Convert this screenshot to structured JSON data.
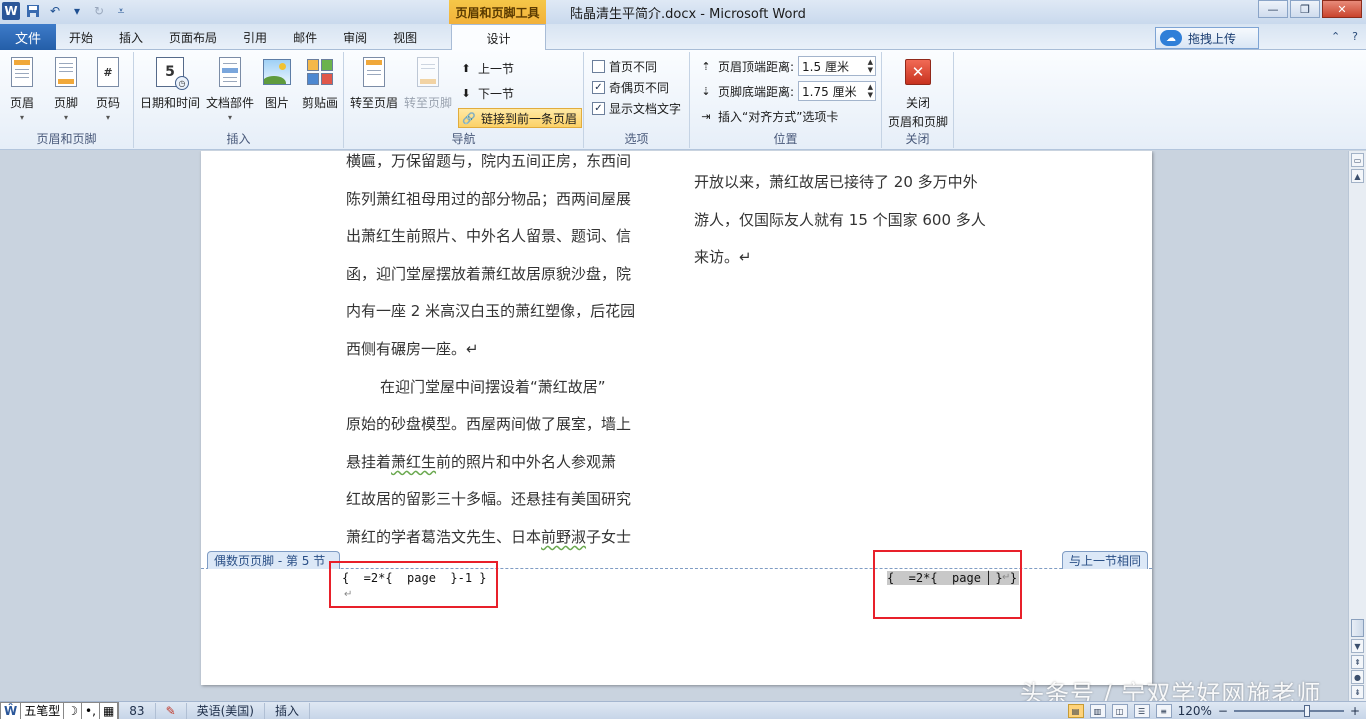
{
  "window": {
    "title": "陆晶清生平简介.docx - Microsoft Word",
    "context_tab_header": "页眉和页脚工具",
    "controls": [
      "—",
      "❐",
      "✕"
    ]
  },
  "qat": {
    "logo": "W",
    "undo_dropdown": "▾"
  },
  "tabs": {
    "file": "文件",
    "items": [
      "开始",
      "插入",
      "页面布局",
      "引用",
      "邮件",
      "审阅",
      "视图"
    ],
    "design": "设计"
  },
  "upload": {
    "label": "拖拽上传",
    "icon": "cloud-icon"
  },
  "ribbon": {
    "groups": {
      "header_footer": {
        "label": "页眉和页脚",
        "buttons": [
          {
            "label": "页眉",
            "icon": "header-icon"
          },
          {
            "label": "页脚",
            "icon": "footer-icon"
          },
          {
            "label": "页码",
            "icon": "page-number-icon"
          }
        ]
      },
      "insert": {
        "label": "插入",
        "buttons": [
          {
            "label": "日期和时间",
            "icon": "calendar-icon"
          },
          {
            "label": "文档部件",
            "icon": "quick-parts-icon"
          },
          {
            "label": "图片",
            "icon": "picture-icon"
          },
          {
            "label": "剪贴画",
            "icon": "clipart-icon"
          }
        ]
      },
      "navigation": {
        "label": "导航",
        "goto_header": "转至页眉",
        "goto_footer": "转至页脚",
        "previous": "上一节",
        "next": "下一节",
        "link_previous": "链接到前一条页眉"
      },
      "options": {
        "label": "选项",
        "items": [
          {
            "label": "首页不同",
            "checked": false
          },
          {
            "label": "奇偶页不同",
            "checked": true
          },
          {
            "label": "显示文档文字",
            "checked": true
          }
        ]
      },
      "position": {
        "label": "位置",
        "header_top_label": "页眉顶端距离:",
        "header_top_value": "1.5 厘米",
        "footer_bottom_label": "页脚底端距离:",
        "footer_bottom_value": "1.75 厘米",
        "insert_align_tab": "插入“对齐方式”选项卡"
      },
      "close": {
        "label": "关闭",
        "button_line1": "关闭",
        "button_line2": "页眉和页脚"
      }
    }
  },
  "document": {
    "col1": [
      {
        "text": "横匾，万保留题与，院内五间正房，东西间",
        "type": "line"
      },
      {
        "text": "陈列萧红祖母用过的部分物品；西两间屋展",
        "type": "line"
      },
      {
        "text": "出萧红生前照片、中外名人留景、题词、信",
        "type": "line"
      },
      {
        "text": "函，迎门堂屋摆放着萧红故居原貌沙盘，院",
        "type": "line"
      },
      {
        "text": "内有一座 2 米高汉白玉的萧红塑像，后花园",
        "type": "line"
      },
      {
        "text": "西侧有碾房一座。↵",
        "type": "line"
      },
      {
        "text": "在迎门堂屋中间摆设着“萧红故居”",
        "type": "indent"
      },
      {
        "text": "原始的砂盘模型。西屋两间做了展室，墙上",
        "type": "line"
      },
      {
        "text_before": "悬挂着",
        "text_wavy": "萧红生",
        "text_after": "前的照片和中外名人参观萧",
        "type": "wavy"
      },
      {
        "text": "红故居的留影三十多幅。还悬挂有美国研究",
        "type": "line"
      },
      {
        "text_before": "萧红的学者葛浩文先生、日本",
        "text_wavy": "前野淑",
        "text_after": "子女士",
        "type": "wavy"
      }
    ],
    "col2": [
      "开放以来，萧红故居已接待了 20 多万中外",
      "游人，仅国际友人就有 15 个国家 600 多人",
      "来访。↵"
    ],
    "footer_left_tag": "偶数页页脚 - 第 5 节 -",
    "footer_right_tag": "与上一节相同",
    "field_left": "{  =2*{  page  }-1 }",
    "field_left_mark": "↵",
    "field_right": "{  =2*{  page ▏} }",
    "field_right_mark": "↵"
  },
  "watermark": "头条号 / 宁双学好网施老师",
  "statusbar": {
    "ime": [
      "五笔型",
      "☽",
      "•,",
      "▦"
    ],
    "page_count": "83",
    "language": "英语(美国)",
    "mode": "插入",
    "zoom": "120%",
    "minus": "−",
    "plus": "+"
  },
  "colors": {
    "accent": "#245ea8",
    "context_tab": "#f2b13a",
    "highlight_box": "#e8202a"
  }
}
